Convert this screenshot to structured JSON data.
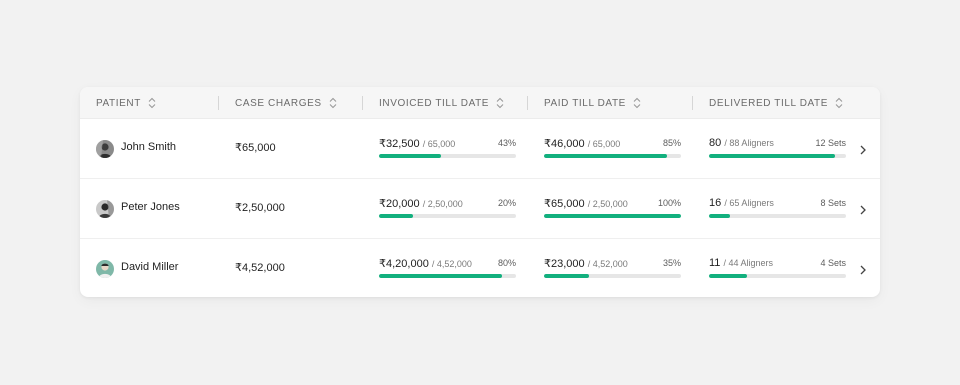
{
  "colors": {
    "accent": "#12b07e",
    "track": "#e6e6e6",
    "header_bg": "#f6f6f6"
  },
  "columns": [
    {
      "key": "patient",
      "label": "PATIENT"
    },
    {
      "key": "case_charges",
      "label": "CASE CHARGES"
    },
    {
      "key": "invoiced",
      "label": "INVOICED TILL DATE"
    },
    {
      "key": "paid",
      "label": "PAID TILL DATE"
    },
    {
      "key": "delivered",
      "label": "DELIVERED TILL DATE"
    }
  ],
  "rows": [
    {
      "name": "John Smith",
      "case_charges": "₹65,000",
      "invoiced": {
        "amount": "₹32,500",
        "total": "/ 65,000",
        "percent_label": "43%",
        "fraction": 0.45
      },
      "paid": {
        "amount": "₹46,000",
        "total": "/ 65,000",
        "percent_label": "85%",
        "fraction": 0.9
      },
      "delivered": {
        "amount": "80",
        "total": "/ 88 Aligners",
        "sets": "12 Sets",
        "fraction": 0.92
      }
    },
    {
      "name": "Peter Jones",
      "case_charges": "₹2,50,000",
      "invoiced": {
        "amount": "₹20,000",
        "total": "/ 2,50,000",
        "percent_label": "20%",
        "fraction": 0.25
      },
      "paid": {
        "amount": "₹65,000",
        "total": "/ 2,50,000",
        "percent_label": "100%",
        "fraction": 1.0
      },
      "delivered": {
        "amount": "16",
        "total": "/ 65 Aligners",
        "sets": "8 Sets",
        "fraction": 0.15
      }
    },
    {
      "name": "David Miller",
      "case_charges": "₹4,52,000",
      "invoiced": {
        "amount": "₹4,20,000",
        "total": "/ 4,52,000",
        "percent_label": "80%",
        "fraction": 0.9
      },
      "paid": {
        "amount": "₹23,000",
        "total": "/ 4,52,000",
        "percent_label": "35%",
        "fraction": 0.33
      },
      "delivered": {
        "amount": "11",
        "total": "/ 44 Aligners",
        "sets": "4 Sets",
        "fraction": 0.28
      }
    }
  ]
}
